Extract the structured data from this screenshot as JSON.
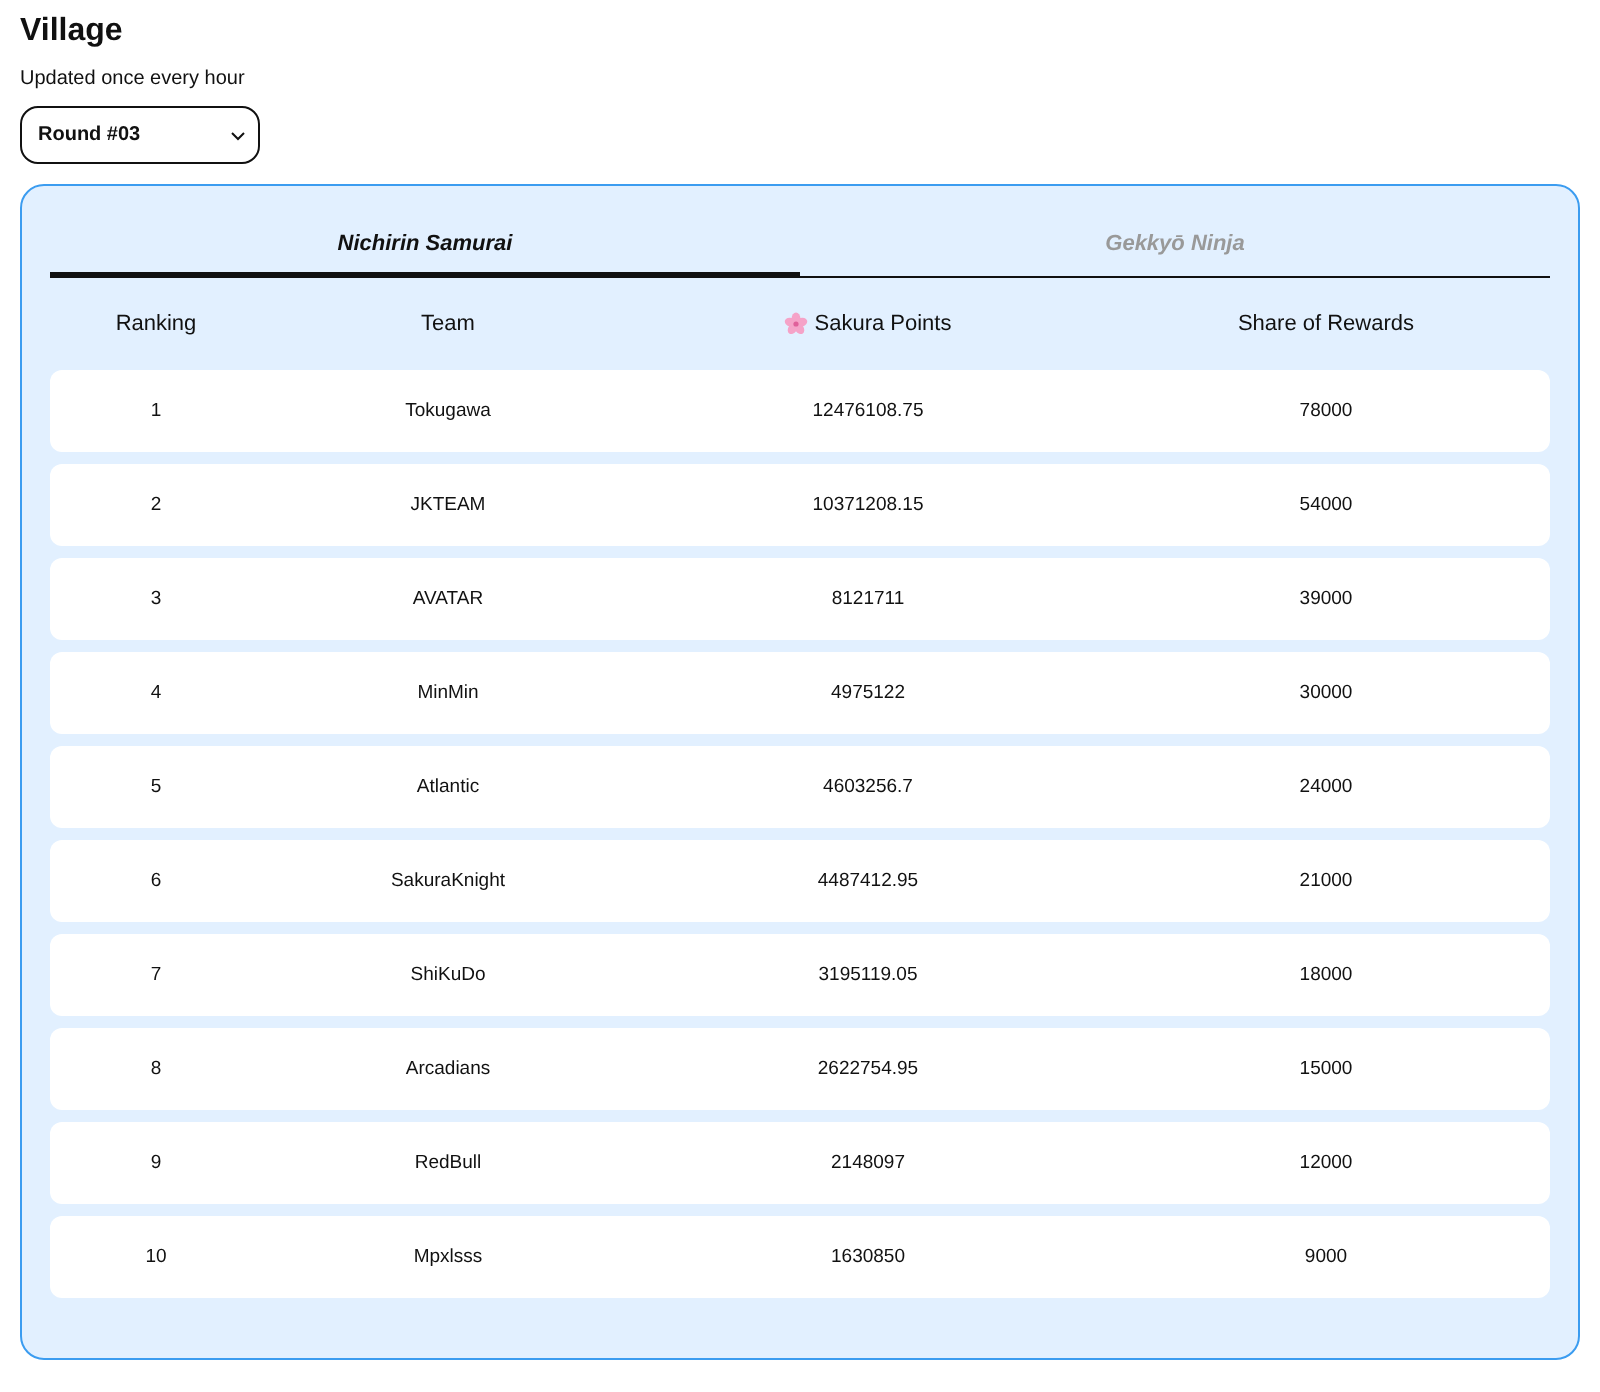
{
  "page": {
    "title": "Village",
    "subtitle": "Updated once every hour"
  },
  "round_select": {
    "value": "Round #03"
  },
  "tabs": [
    {
      "label": "Nichirin Samurai",
      "selected": true
    },
    {
      "label": "Gekkyō Ninja",
      "selected": false
    }
  ],
  "table": {
    "columns": [
      "Ranking",
      "Team",
      "Sakura Points",
      "Share of Rewards"
    ],
    "rows": [
      [
        "1",
        "Tokugawa",
        "12476108.75",
        "78000"
      ],
      [
        "2",
        "JKTEAM",
        "10371208.15",
        "54000"
      ],
      [
        "3",
        "AVATAR",
        "8121711",
        "39000"
      ],
      [
        "4",
        "MinMin",
        "4975122",
        "30000"
      ],
      [
        "5",
        "Atlantic",
        "4603256.7",
        "24000"
      ],
      [
        "6",
        "SakuraKnight",
        "4487412.95",
        "21000"
      ],
      [
        "7",
        "ShiKuDo",
        "3195119.05",
        "18000"
      ],
      [
        "8",
        "Arcadians",
        "2622754.95",
        "15000"
      ],
      [
        "9",
        "RedBull",
        "2148097",
        "12000"
      ],
      [
        "10",
        "Mpxlsss",
        "1630850",
        "9000"
      ]
    ]
  }
}
